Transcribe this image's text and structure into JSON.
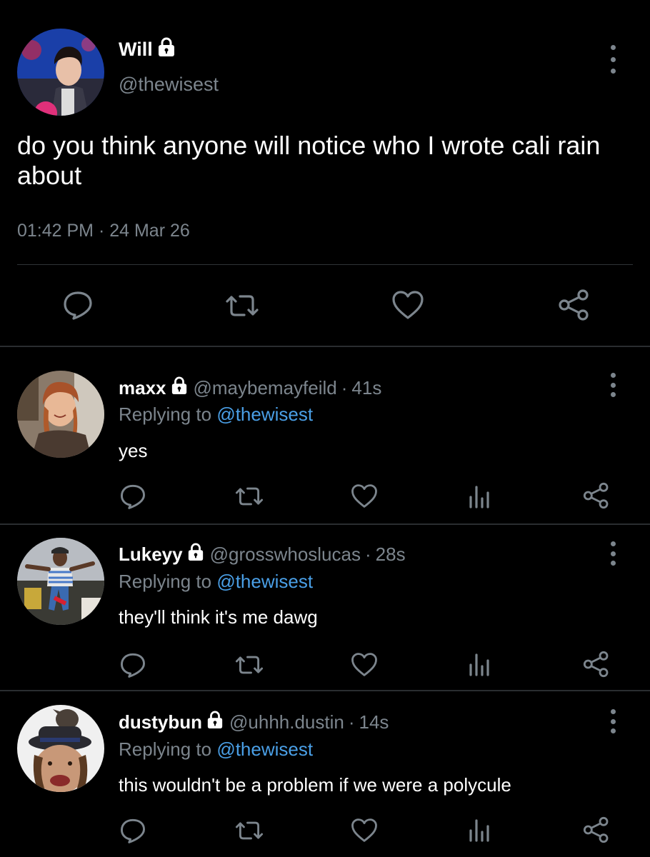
{
  "main_tweet": {
    "name": "Will",
    "handle": "@thewisest",
    "text": "do you think anyone will notice who I wrote cali rain about",
    "timestamp": "01:42 PM · 24 Mar 26",
    "actions": [
      "reply-icon",
      "retweet-icon",
      "like-icon",
      "share-icon"
    ]
  },
  "replies": [
    {
      "name": "maxx",
      "handle": "@maybemayfeild",
      "separator": "·",
      "time": "41s",
      "replying_prefix": "Replying to ",
      "replying_to": "@thewisest",
      "text": "yes"
    },
    {
      "name": "Lukeyy",
      "handle": "@grosswhoslucas",
      "separator": "·",
      "time": "28s",
      "replying_prefix": "Replying to ",
      "replying_to": "@thewisest",
      "text": "they'll think it's me dawg"
    },
    {
      "name": "dustybun",
      "handle": "@uhhh.dustin",
      "separator": "·",
      "time": "14s",
      "replying_prefix": "Replying to ",
      "replying_to": "@thewisest",
      "text": "this wouldn't be a problem if we were a polycule"
    }
  ],
  "colors": {
    "background": "#000000",
    "text": "#ffffff",
    "muted": "#7c858d",
    "link": "#4a9fe6",
    "divider": "#2f3336"
  }
}
